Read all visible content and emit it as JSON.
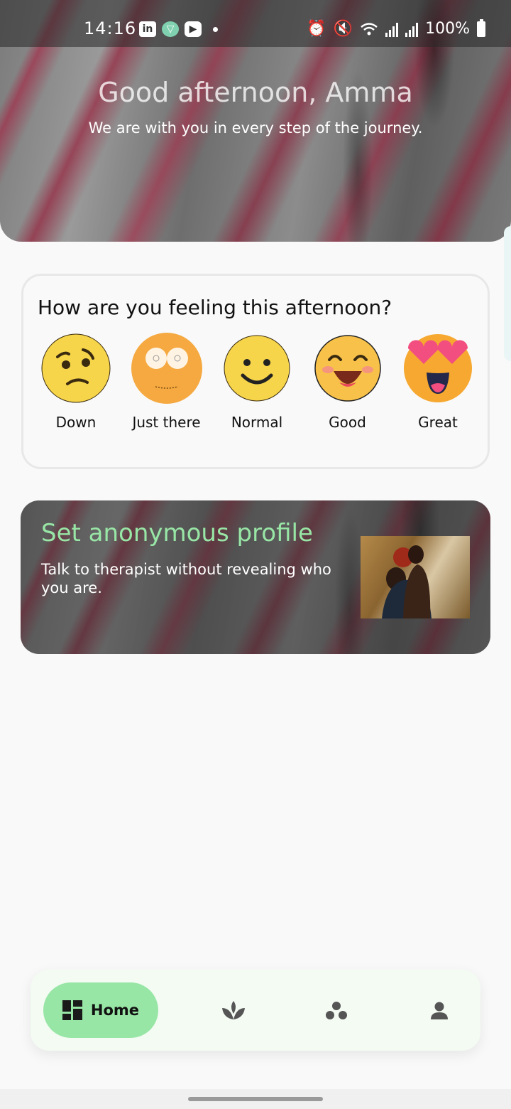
{
  "status_bar": {
    "time": "14:16",
    "apps": [
      "linkedin-icon",
      "vpn-icon",
      "youtube-icon"
    ],
    "battery": "100%"
  },
  "header": {
    "greeting": "Good afternoon, Amma",
    "subtitle": "We are with you in every step of the journey."
  },
  "mood": {
    "question": "How are you feeling this afternoon?",
    "options": [
      {
        "label": "Down",
        "icon": "worried-face-icon"
      },
      {
        "label": "Just there",
        "icon": "blank-face-icon"
      },
      {
        "label": "Normal",
        "icon": "smiling-face-icon"
      },
      {
        "label": "Good",
        "icon": "happy-face-icon"
      },
      {
        "label": "Great",
        "icon": "heart-eyes-face-icon"
      }
    ]
  },
  "profile_card": {
    "title": "Set anonymous profile",
    "description": "Talk to therapist without revealing who you are."
  },
  "bottom_nav": {
    "items": [
      {
        "label": "Home",
        "icon": "dashboard-icon",
        "active": true
      },
      {
        "label": "",
        "icon": "lotus-icon",
        "active": false
      },
      {
        "label": "",
        "icon": "community-icon",
        "active": false
      },
      {
        "label": "",
        "icon": "profile-icon",
        "active": false
      }
    ]
  },
  "colors": {
    "accent": "#98e6a6",
    "background": "#f9f9f9",
    "nav_background": "#f3fbf3"
  }
}
